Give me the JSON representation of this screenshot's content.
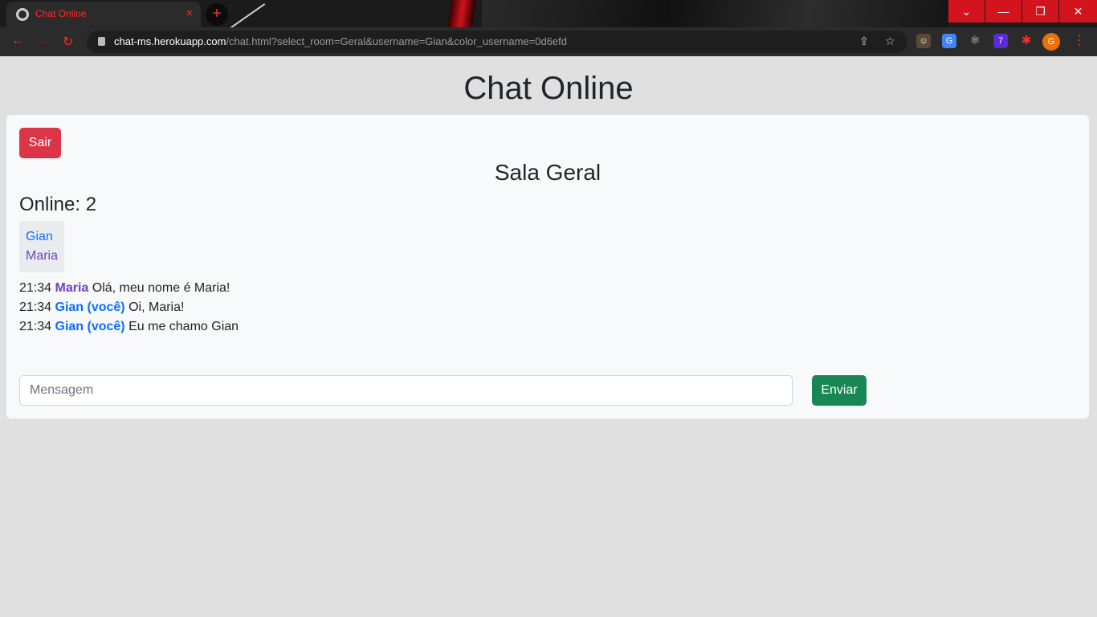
{
  "browser": {
    "tab_title": "Chat Online",
    "tab_close": "×",
    "new_tab": "+",
    "url_host": "chat-ms.herokuapp.com",
    "url_path": "/chat.html?select_room=Geral&username=Gian&color_username=0d6efd",
    "extension_badge": "7",
    "profile_initial": "G",
    "accent_color": "#ff2b2b"
  },
  "page": {
    "title": "Chat Online",
    "leave_button": "Sair",
    "room_title": "Sala Geral",
    "online_label": "Online: 2",
    "users": [
      {
        "name": "Gian",
        "color": "#0d6efd"
      },
      {
        "name": "Maria",
        "color": "#6f42c1"
      }
    ],
    "messages": [
      {
        "time": "21:34",
        "author": "Maria",
        "text": "Olá, meu nome é Maria!",
        "color": "#6f42c1"
      },
      {
        "time": "21:34",
        "author": "Gian (você)",
        "text": "Oi, Maria!",
        "color": "#0d6efd"
      },
      {
        "time": "21:34",
        "author": "Gian (você)",
        "text": "Eu me chamo Gian",
        "color": "#0d6efd"
      }
    ],
    "message_placeholder": "Mensagem",
    "send_button": "Enviar",
    "colors": {
      "danger": "#dc3545",
      "success": "#198754"
    }
  }
}
